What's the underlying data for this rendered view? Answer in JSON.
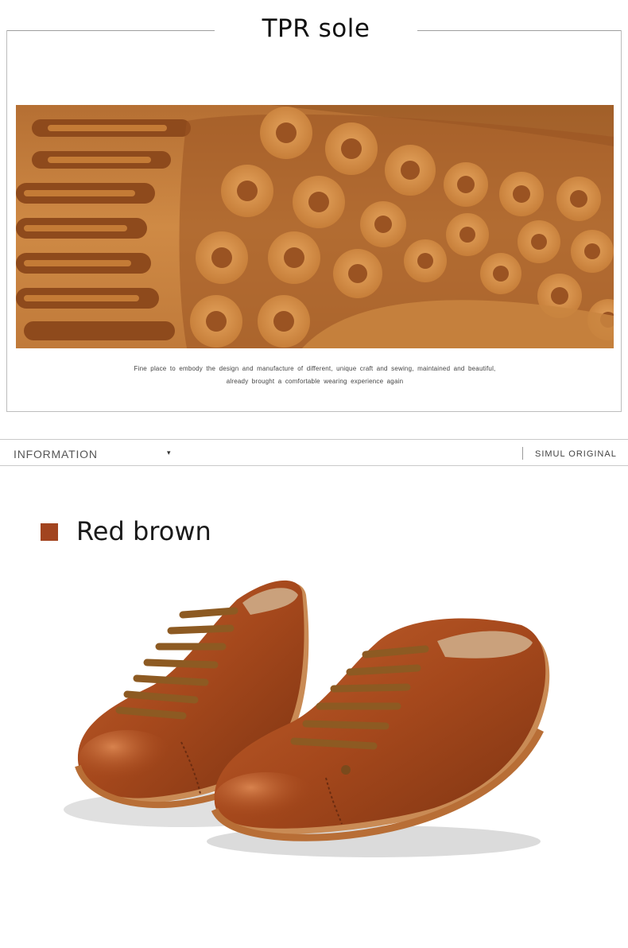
{
  "section_title": "TPR sole",
  "caption": {
    "line1": "Fine place to embody the design and manufacture of different, unique craft and sewing, maintained and beautiful,",
    "line2": "already brought a comfortable wearing experience again"
  },
  "info_bar": {
    "label": "INFORMATION",
    "arrow": "▾",
    "brand": "SIMUL ORIGINAL"
  },
  "color_heading": {
    "name": "Red brown",
    "swatch_color": "#a2441f"
  },
  "images": {
    "sole": "sole-tread-photo",
    "shoes": "red-brown-shoes-photo"
  },
  "colors": {
    "sole_base": "#c8823e",
    "sole_groove": "#8e4a1c",
    "leather": "#a5481c",
    "lace": "#8d5a22",
    "rule": "#bdbdbd"
  }
}
